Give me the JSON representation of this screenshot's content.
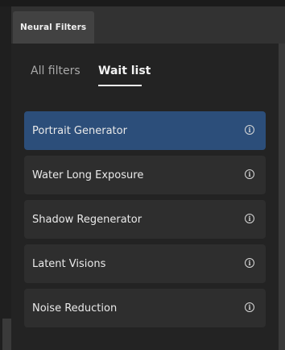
{
  "header": {
    "tab_label": "Neural Filters"
  },
  "filter_tabs": [
    {
      "label": "All filters",
      "active": false
    },
    {
      "label": "Wait list",
      "active": true
    }
  ],
  "filters": [
    {
      "label": "Portrait Generator",
      "selected": true,
      "icon": "info-icon"
    },
    {
      "label": "Water Long Exposure",
      "selected": false,
      "icon": "info-icon"
    },
    {
      "label": "Shadow Regenerator",
      "selected": false,
      "icon": "info-icon"
    },
    {
      "label": "Latent Visions",
      "selected": false,
      "icon": "info-icon"
    },
    {
      "label": "Noise Reduction",
      "selected": false,
      "icon": "info-icon"
    }
  ],
  "colors": {
    "panel_bg": "#232323",
    "item_bg": "#2e2e2e",
    "selected_bg": "#2c4e7a",
    "text": "#eaeaea",
    "inactive_tab_text": "#a9a9a9"
  }
}
